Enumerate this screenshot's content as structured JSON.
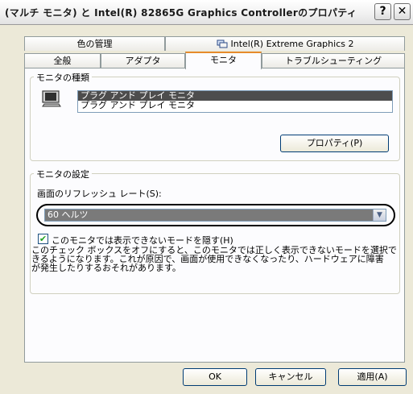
{
  "window": {
    "title": "(マルチ モニタ) と Intel(R) 82865G Graphics Controllerのプロパティ",
    "help_glyph": "?",
    "close_glyph": "✕"
  },
  "tabs": {
    "row1": [
      {
        "label": "色の管理",
        "icon": ""
      },
      {
        "label": "Intel(R) Extreme Graphics 2",
        "icon": "intel-graphics-icon"
      }
    ],
    "row2": [
      {
        "label": "全般"
      },
      {
        "label": "アダプタ"
      },
      {
        "label": "モニタ",
        "active": true
      },
      {
        "label": "トラブルシューティング"
      }
    ]
  },
  "monitor_type": {
    "group_title": "モニタの種類",
    "items": [
      {
        "label": "プラグ アンド プレイ モニタ",
        "selected": true
      },
      {
        "label": "プラグ アンド プレイ モニタ",
        "selected": false
      }
    ],
    "properties_button": "プロパティ(P)"
  },
  "monitor_settings": {
    "group_title": "モニタの設定",
    "refresh_label": "画面のリフレッシュ レート(S):",
    "refresh_value": "60 ヘルツ",
    "hide_modes_label": "このモニタでは表示できないモードを隠す(H)",
    "hide_modes_checked": true,
    "description_lines": [
      "このチェック ボックスをオフにすると、このモニタでは正しく表示できないモードを選択で",
      "きるようになります。これが原因で、画面が使用できなくなったり、ハードウェアに障害",
      "が発生したりするおそれがあります。"
    ]
  },
  "footer": {
    "ok_label": "OK",
    "cancel_label": "キャンセル",
    "apply_label": "適用(A)"
  }
}
